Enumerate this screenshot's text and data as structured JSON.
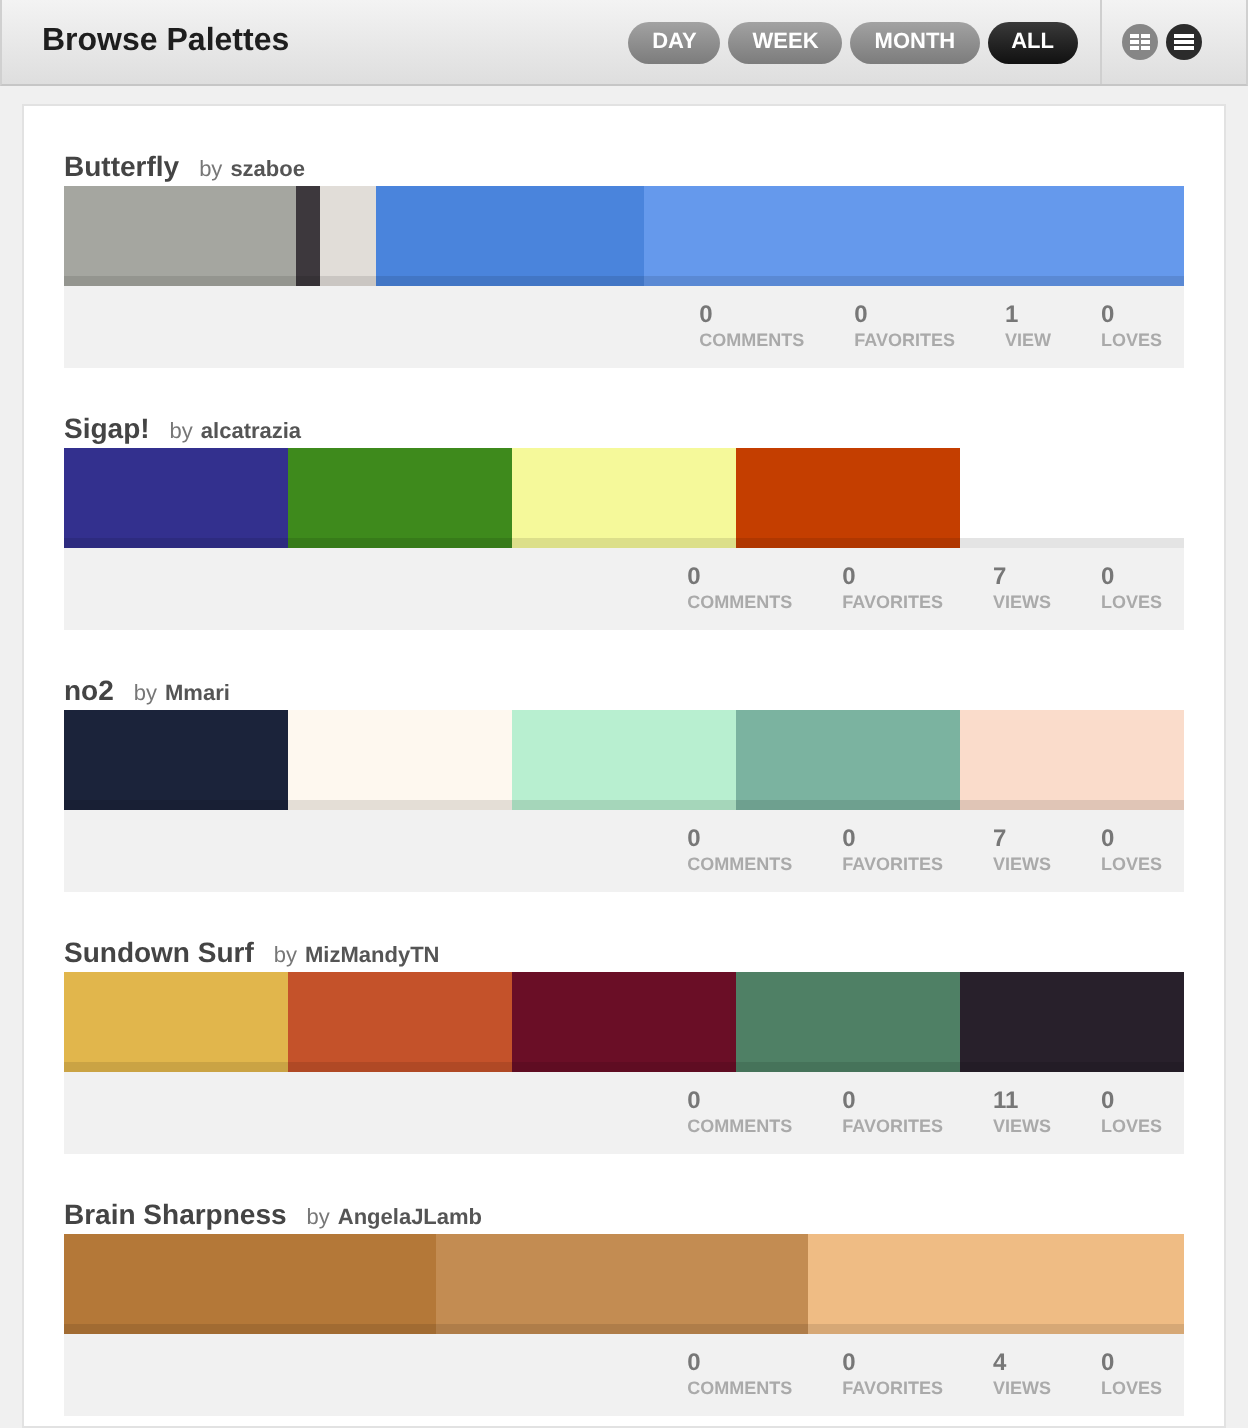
{
  "header": {
    "title": "Browse Palettes",
    "filters": [
      {
        "label": "DAY",
        "selected": false
      },
      {
        "label": "WEEK",
        "selected": false
      },
      {
        "label": "MONTH",
        "selected": false
      },
      {
        "label": "ALL",
        "selected": true
      }
    ],
    "views": [
      {
        "kind": "grid",
        "selected": false
      },
      {
        "kind": "list",
        "selected": true
      }
    ]
  },
  "palettes": [
    {
      "title": "Butterfly",
      "by": "by",
      "author": "szaboe",
      "swatches": [
        {
          "color": "#a5a6a0"
        },
        {
          "color": "#3d383d"
        },
        {
          "color": "#e1ddd8"
        },
        {
          "color": "#4a84dc"
        },
        {
          "color": "#6599ec"
        }
      ],
      "stats": [
        {
          "value": "0",
          "label": "COMMENTS"
        },
        {
          "value": "0",
          "label": "FAVORITES"
        },
        {
          "value": "1",
          "label": "VIEW"
        },
        {
          "value": "0",
          "label": "LOVES"
        }
      ]
    },
    {
      "title": "Sigap!",
      "by": "by",
      "author": "alcatrazia",
      "swatches": [
        {
          "color": "#33308e"
        },
        {
          "color": "#3e8a1c"
        },
        {
          "color": "#f5f99a"
        },
        {
          "color": "#c43e00"
        }
      ],
      "stats": [
        {
          "value": "0",
          "label": "COMMENTS"
        },
        {
          "value": "0",
          "label": "FAVORITES"
        },
        {
          "value": "7",
          "label": "VIEWS"
        },
        {
          "value": "0",
          "label": "LOVES"
        }
      ]
    },
    {
      "title": "no2",
      "by": "by",
      "author": "Mmari",
      "swatches": [
        {
          "color": "#1b233a"
        },
        {
          "color": "#fef8ef"
        },
        {
          "color": "#b8efd0"
        },
        {
          "color": "#7bb3a0"
        },
        {
          "color": "#fadccb"
        }
      ],
      "stats": [
        {
          "value": "0",
          "label": "COMMENTS"
        },
        {
          "value": "0",
          "label": "FAVORITES"
        },
        {
          "value": "7",
          "label": "VIEWS"
        },
        {
          "value": "0",
          "label": "LOVES"
        }
      ]
    },
    {
      "title": "Sundown Surf",
      "by": "by",
      "author": "MizMandyTN",
      "swatches": [
        {
          "color": "#e1b64c"
        },
        {
          "color": "#c4522a"
        },
        {
          "color": "#6a0e26"
        },
        {
          "color": "#4f8065"
        },
        {
          "color": "#28202b"
        }
      ],
      "stats": [
        {
          "value": "0",
          "label": "COMMENTS"
        },
        {
          "value": "0",
          "label": "FAVORITES"
        },
        {
          "value": "11",
          "label": "VIEWS"
        },
        {
          "value": "0",
          "label": "LOVES"
        }
      ]
    },
    {
      "title": "Brain Sharpness",
      "by": "by",
      "author": "AngelaJLamb",
      "swatches": [
        {
          "color": "#b47838"
        },
        {
          "color": "#c38c52"
        },
        {
          "color": "#efbc84"
        }
      ],
      "stats": [
        {
          "value": "0",
          "label": "COMMENTS"
        },
        {
          "value": "0",
          "label": "FAVORITES"
        },
        {
          "value": "4",
          "label": "VIEWS"
        },
        {
          "value": "0",
          "label": "LOVES"
        }
      ]
    }
  ]
}
